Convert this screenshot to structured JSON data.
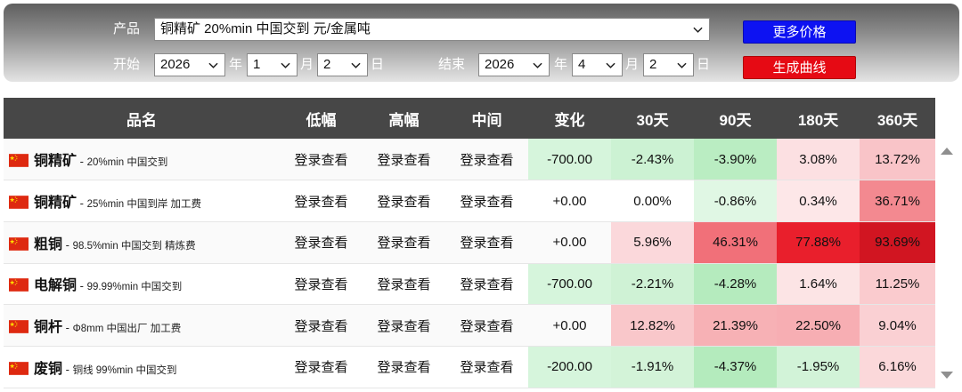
{
  "controls": {
    "product_label": "产品",
    "product_value": "铜精矿 20%min 中国交到 元/金属吨",
    "start_label": "开始",
    "end_label": "结束",
    "year_unit": "年",
    "month_unit": "月",
    "day_unit": "日",
    "start": {
      "year": "2026",
      "month": "1",
      "day": "2"
    },
    "end": {
      "year": "2026",
      "month": "4",
      "day": "2"
    },
    "more_prices_button": "更多价格",
    "generate_curve_button": "生成曲线"
  },
  "table": {
    "headers": [
      "品名",
      "低幅",
      "高幅",
      "中间",
      "变化",
      "30天",
      "90天",
      "180天",
      "360天"
    ],
    "rows": [
      {
        "name": "铜精矿",
        "desc": "20%min 中国交到",
        "low": "登录查看",
        "high": "登录查看",
        "mid": "登录查看",
        "change": "-700.00",
        "d30": "-2.43%",
        "d90": "-3.90%",
        "d180": "3.08%",
        "d360": "13.72%"
      },
      {
        "name": "铜精矿",
        "desc": "25%min 中国到岸 加工费",
        "low": "登录查看",
        "high": "登录查看",
        "mid": "登录查看",
        "change": "+0.00",
        "d30": "0.00%",
        "d90": "-0.86%",
        "d180": "0.34%",
        "d360": "36.71%"
      },
      {
        "name": "粗铜",
        "desc": "98.5%min 中国交到 精炼费",
        "low": "登录查看",
        "high": "登录查看",
        "mid": "登录查看",
        "change": "+0.00",
        "d30": "5.96%",
        "d90": "46.31%",
        "d180": "77.88%",
        "d360": "93.69%"
      },
      {
        "name": "电解铜",
        "desc": "99.99%min 中国交到",
        "low": "登录查看",
        "high": "登录查看",
        "mid": "登录查看",
        "change": "-700.00",
        "d30": "-2.21%",
        "d90": "-4.28%",
        "d180": "1.64%",
        "d360": "11.25%"
      },
      {
        "name": "铜杆",
        "desc": "Φ8mm 中国出厂 加工费",
        "low": "登录查看",
        "high": "登录查看",
        "mid": "登录查看",
        "change": "+0.00",
        "d30": "12.82%",
        "d90": "21.39%",
        "d180": "22.50%",
        "d360": "9.04%"
      },
      {
        "name": "废铜",
        "desc": "铜线 99%min 中国交到",
        "low": "登录查看",
        "high": "登录查看",
        "mid": "登录查看",
        "change": "-200.00",
        "d30": "-1.91%",
        "d90": "-4.37%",
        "d180": "-1.95%",
        "d360": "6.16%"
      }
    ]
  },
  "colors": {
    "header_bg": "#474747",
    "more_button": "#0d12f2",
    "curve_button": "#e60a14",
    "flag": "#de2910",
    "flag_star": "#ffde00"
  },
  "icons": {
    "flag": "china-flag-icon",
    "dropdown": "chevron-down-icon",
    "scroll_up": "triangle-up-icon",
    "scroll_down": "triangle-down-icon"
  }
}
